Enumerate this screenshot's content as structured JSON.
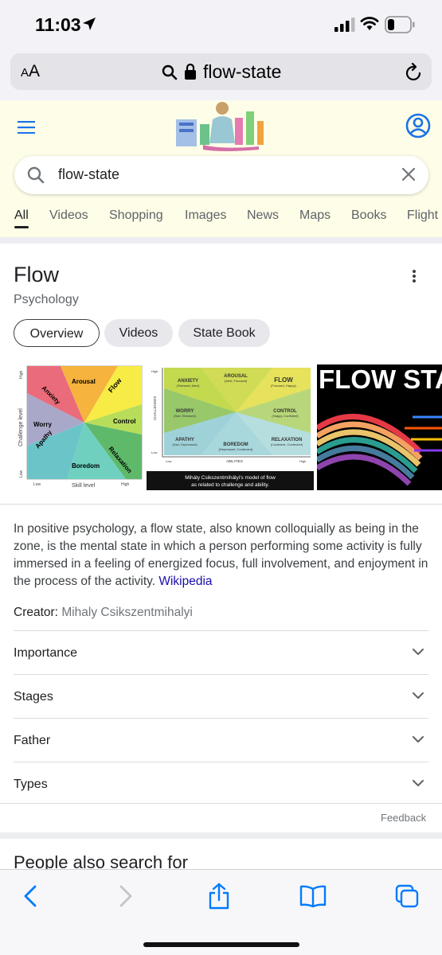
{
  "status": {
    "time": "11:03"
  },
  "url_bar": {
    "aa_small": "A",
    "aa_big": "A",
    "url": "flow-state"
  },
  "search": {
    "query": "flow-state"
  },
  "tabs": [
    "All",
    "Videos",
    "Shopping",
    "Images",
    "News",
    "Maps",
    "Books",
    "Flight"
  ],
  "knowledge_panel": {
    "title": "Flow",
    "subtitle": "Psychology",
    "chips": [
      "Overview",
      "Videos",
      "State Book"
    ],
    "images": {
      "img1": {
        "segments": [
          "Arousal",
          "Flow",
          "Control",
          "Relaxation",
          "Boredom",
          "Apathy",
          "Worry",
          "Anxiety"
        ],
        "y_axis": "Challenge level",
        "y_high": "High",
        "y_low": "Low",
        "x_axis": "Skill level",
        "x_low": "Low",
        "x_high": "High"
      },
      "img2": {
        "cells": [
          {
            "title": "ANXIETY",
            "sub": "(Stressed, Alert)"
          },
          {
            "title": "AROUSAL",
            "sub": "(Alert, Focused)"
          },
          {
            "title": "FLOW",
            "sub": "(Focused, Happy)"
          },
          {
            "title": "WORRY",
            "sub": "(Sad, Stressed)"
          },
          {
            "title": "CONTROL",
            "sub": "(Happy, Confident)"
          },
          {
            "title": "APATHY",
            "sub": "(Sad, Depressed)"
          },
          {
            "title": "BOREDOM",
            "sub": "(Depressed, Contented)"
          },
          {
            "title": "RELAXATION",
            "sub": "(Confident, Contented)"
          }
        ],
        "y_axis": "CHALLENGES",
        "x_axis": "ABILITIES",
        "high": "High",
        "low": "Low",
        "caption1": "Mihály Csikszentmihályi's model of flow",
        "caption2": "as related to challenge and ability."
      },
      "img3": {
        "text": "FLOW STA"
      }
    },
    "description": "In positive psychology, a flow state, also known colloquially as being in the zone, is the mental state in which a person performing some activity is fully immersed in a feeling of energized focus, full involvement, and enjoyment in the process of the activity.",
    "source": "Wikipedia",
    "creator_label": "Creator:",
    "creator_value": "Mihaly Csikszentmihalyi",
    "accordion": [
      "Importance",
      "Stages",
      "Father",
      "Types"
    ],
    "feedback": "Feedback"
  },
  "people_also_search": "People also search for",
  "colors": {
    "accent": "#1a73e8",
    "link": "#1a0dab",
    "ios_blue": "#007aff",
    "doodle_bg": "#fefde8"
  },
  "icons": {
    "status": [
      "location-arrow-icon",
      "cellular-signal-icon",
      "wifi-icon",
      "battery-icon"
    ],
    "toolbar": [
      "back-icon",
      "forward-icon",
      "share-icon",
      "bookmarks-icon",
      "tabs-icon"
    ]
  }
}
